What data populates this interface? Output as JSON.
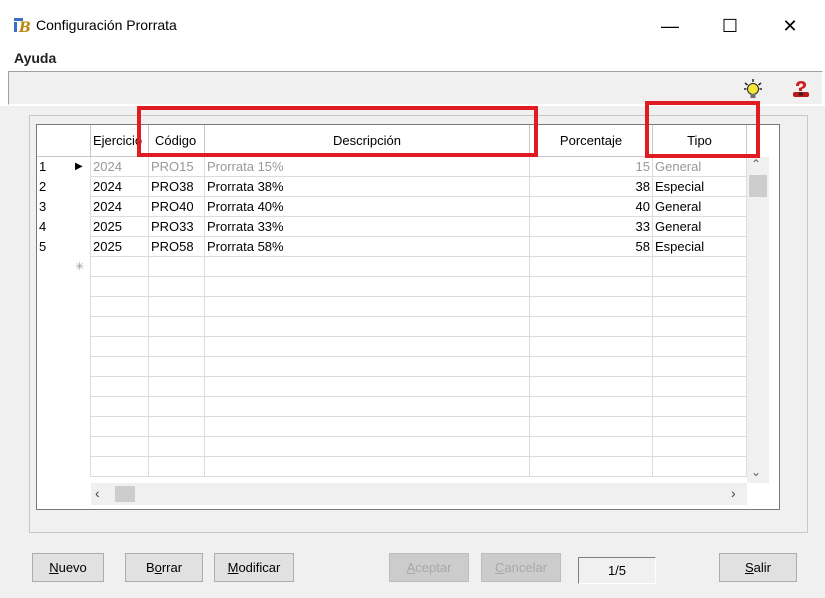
{
  "window": {
    "title": "Configuración Prorrata",
    "minimize": "—",
    "maximize": "☐",
    "close": "✕"
  },
  "menu": {
    "items": [
      "Ayuda"
    ]
  },
  "toolbar": {
    "icons": [
      "lightbulb-icon",
      "help-icon"
    ]
  },
  "grid": {
    "columns": [
      "Ejercicio",
      "Código",
      "Descripción",
      "Porcentaje",
      "Tipo"
    ],
    "rows": [
      {
        "n": "1",
        "ejercicio": "2024",
        "codigo": "PRO15",
        "descripcion": "Prorrata 15%",
        "porcentaje": "15",
        "tipo": "General"
      },
      {
        "n": "2",
        "ejercicio": "2024",
        "codigo": "PRO38",
        "descripcion": "Prorrata 38%",
        "porcentaje": "38",
        "tipo": "Especial"
      },
      {
        "n": "3",
        "ejercicio": "2024",
        "codigo": "PRO40",
        "descripcion": "Prorrata 40%",
        "porcentaje": "40",
        "tipo": "General"
      },
      {
        "n": "4",
        "ejercicio": "2025",
        "codigo": "PRO33",
        "descripcion": "Prorrata 33%",
        "porcentaje": "33",
        "tipo": "General"
      },
      {
        "n": "5",
        "ejercicio": "2025",
        "codigo": "PRO58",
        "descripcion": "Prorrata 58%",
        "porcentaje": "58",
        "tipo": "Especial"
      }
    ],
    "current_row_marker": "▶",
    "new_row_marker": "✳"
  },
  "buttons": {
    "nuevo": {
      "label": "Nuevo",
      "hotkey_index": 0
    },
    "borrar": {
      "label": "Borrar",
      "hotkey_index": 1
    },
    "modificar": {
      "label": "Modificar",
      "hotkey_index": 0
    },
    "aceptar": {
      "label": "Aceptar",
      "hotkey_index": 0
    },
    "cancelar": {
      "label": "Cancelar",
      "hotkey_index": 0
    },
    "salir": {
      "label": "Salir",
      "hotkey_index": 0
    }
  },
  "pager": {
    "text": "1/5"
  },
  "colors": {
    "highlight": "#e11b22",
    "chrome": "#f0f0f0"
  }
}
